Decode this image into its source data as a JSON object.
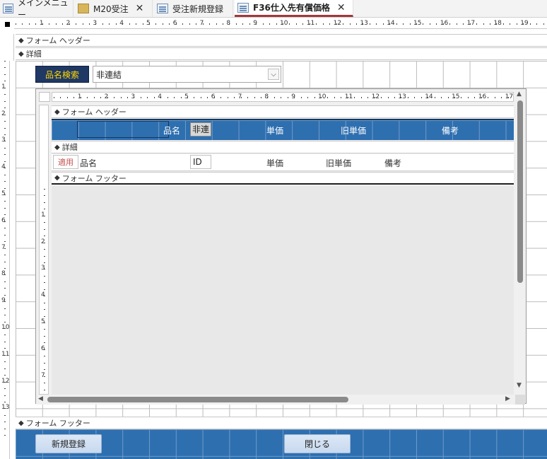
{
  "tabs": [
    {
      "label": "メインメニュー",
      "closable": false
    },
    {
      "label": "M20受注",
      "closable": true
    },
    {
      "label": "受注新規登録",
      "closable": false
    },
    {
      "label": "F36仕入先有償価格",
      "closable": true,
      "active": true
    }
  ],
  "ruler_numbers": [
    "1",
    "2",
    "3",
    "4",
    "5",
    "6",
    "7",
    "8",
    "9",
    "10",
    "11",
    "12",
    "13",
    "14",
    "15",
    "16",
    "17",
    "18",
    "19"
  ],
  "sub_ruler_numbers": [
    "1",
    "2",
    "3",
    "4",
    "5",
    "6",
    "7",
    "8",
    "9",
    "10",
    "11",
    "12",
    "13",
    "14",
    "15",
    "16",
    "17"
  ],
  "vruler_numbers": [
    "1",
    "2",
    "3",
    "4",
    "5",
    "6",
    "7",
    "8",
    "9",
    "10",
    "11",
    "12",
    "13"
  ],
  "sub_vruler_numbers": [
    "1",
    "2",
    "3",
    "4",
    "5",
    "6",
    "7"
  ],
  "sections": {
    "form_header": "フォーム ヘッダー",
    "detail": "詳細",
    "form_footer": "フォーム フッター"
  },
  "search": {
    "label": "品名検索",
    "value": "非連結"
  },
  "subform": {
    "header_section": "フォーム ヘッダー",
    "detail_section": "詳細",
    "footer_section": "フォーム フッター",
    "header_labels": {
      "hinmei": "品名",
      "hirenketsu": "非連",
      "tanka": "単価",
      "kyutanka": "旧単価",
      "biko": "備考"
    },
    "detail_fields": {
      "apply": "適用",
      "hinmei": "品名",
      "id": "ID",
      "tanka": "単価",
      "kyutanka": "旧単価",
      "biko": "備考"
    }
  },
  "footer_buttons": {
    "new": "新規登録",
    "close": "閉じる"
  },
  "colors": {
    "accent_blue": "#2e6fb0",
    "label_bg": "#1f3864",
    "label_text": "#ffd700"
  }
}
